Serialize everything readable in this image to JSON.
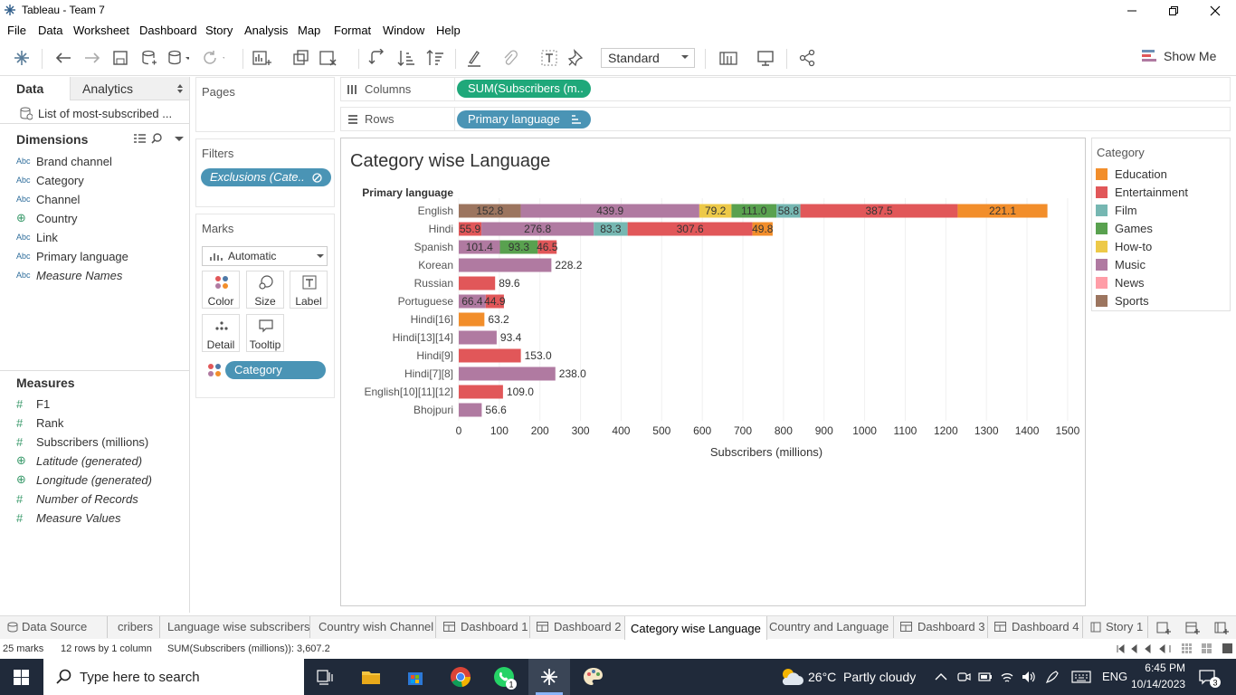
{
  "window": {
    "title": "Tableau - Team 7"
  },
  "menu": [
    "File",
    "Data",
    "Worksheet",
    "Dashboard",
    "Story",
    "Analysis",
    "Map",
    "Format",
    "Window",
    "Help"
  ],
  "toolbar": {
    "mark_type": "Standard",
    "show_me": "Show Me"
  },
  "sidebar": {
    "tabs": [
      "Data",
      "Analytics"
    ],
    "datasource": "List of most-subscribed ...",
    "dimensions_title": "Dimensions",
    "dimensions": [
      {
        "label": "Brand channel",
        "type": "Abc",
        "italic": false
      },
      {
        "label": "Category",
        "type": "Abc",
        "italic": false
      },
      {
        "label": "Channel",
        "type": "Abc",
        "italic": false
      },
      {
        "label": "Country",
        "type": "globe",
        "italic": false
      },
      {
        "label": "Link",
        "type": "Abc",
        "italic": false
      },
      {
        "label": "Primary language",
        "type": "Abc",
        "italic": false
      },
      {
        "label": "Measure Names",
        "type": "Abc",
        "italic": true
      }
    ],
    "measures_title": "Measures",
    "measures": [
      {
        "label": "F1",
        "type": "#",
        "italic": false
      },
      {
        "label": "Rank",
        "type": "#",
        "italic": false
      },
      {
        "label": "Subscribers (millions)",
        "type": "#",
        "italic": false
      },
      {
        "label": "Latitude (generated)",
        "type": "globe",
        "italic": true
      },
      {
        "label": "Longitude (generated)",
        "type": "globe",
        "italic": true
      },
      {
        "label": "Number of Records",
        "type": "#",
        "italic": true
      },
      {
        "label": "Measure Values",
        "type": "#",
        "italic": true
      }
    ]
  },
  "pages": {
    "title": "Pages"
  },
  "filters": {
    "title": "Filters",
    "pill": "Exclusions (Cate.."
  },
  "marks": {
    "title": "Marks",
    "type": "Automatic",
    "buttons": [
      "Color",
      "Size",
      "Label",
      "Detail",
      "Tooltip"
    ],
    "pill": "Category"
  },
  "shelves": {
    "columns_label": "Columns",
    "columns_pill": "SUM(Subscribers (m..",
    "rows_label": "Rows",
    "rows_pill": "Primary language"
  },
  "chart_data": {
    "type": "bar",
    "stacked": true,
    "orientation": "horizontal",
    "title": "Category wise Language",
    "row_header": "Primary language",
    "xlabel": "Subscribers (millions)",
    "xlim": [
      0,
      1500
    ],
    "xticks": [
      0,
      100,
      200,
      300,
      400,
      500,
      600,
      700,
      800,
      900,
      1000,
      1100,
      1200,
      1300,
      1400,
      1500
    ],
    "categories": [
      "English",
      "Hindi",
      "Spanish",
      "Korean",
      "Russian",
      "Portuguese",
      "Hindi[16]",
      "Hindi[13][14]",
      "Hindi[9]",
      "Hindi[7][8]",
      "English[10][11][12]",
      "Bhojpuri"
    ],
    "colors": {
      "Education": "#f28e2b",
      "Entertainment": "#e15759",
      "Film": "#76b7b2",
      "Games": "#59a14f",
      "How-to": "#edc948",
      "Music": "#b07aa1",
      "News": "#ff9da7",
      "Sports": "#9c755f"
    },
    "segments": [
      [
        [
          "Sports",
          152.8
        ],
        [
          "Music",
          439.9
        ],
        [
          "How-to",
          79.2
        ],
        [
          "Games",
          111.0
        ],
        [
          "Film",
          58.8
        ],
        [
          "Entertainment",
          387.5
        ],
        [
          "Education",
          221.1
        ]
      ],
      [
        [
          "Entertainment",
          55.9
        ],
        [
          "Music",
          276.8
        ],
        [
          "Film",
          83.3
        ],
        [
          "Entertainment",
          307.6
        ],
        [
          "Education",
          49.8
        ]
      ],
      [
        [
          "Music",
          101.4
        ],
        [
          "Games",
          93.3
        ],
        [
          "Entertainment",
          46.5
        ]
      ],
      [
        [
          "Music",
          228.2
        ]
      ],
      [
        [
          "Entertainment",
          89.6
        ]
      ],
      [
        [
          "Music",
          66.4
        ],
        [
          "Entertainment",
          44.9
        ]
      ],
      [
        [
          "Education",
          63.2
        ]
      ],
      [
        [
          "Music",
          93.4
        ]
      ],
      [
        [
          "Entertainment",
          153.0
        ]
      ],
      [
        [
          "Music",
          238.0
        ]
      ],
      [
        [
          "Entertainment",
          109.0
        ]
      ],
      [
        [
          "Music",
          56.6
        ]
      ]
    ]
  },
  "legend": {
    "title": "Category",
    "items": [
      {
        "label": "Education",
        "color": "#f28e2b"
      },
      {
        "label": "Entertainment",
        "color": "#e15759"
      },
      {
        "label": "Film",
        "color": "#76b7b2"
      },
      {
        "label": "Games",
        "color": "#59a14f"
      },
      {
        "label": "How-to",
        "color": "#edc948"
      },
      {
        "label": "Music",
        "color": "#b07aa1"
      },
      {
        "label": "News",
        "color": "#ff9da7"
      },
      {
        "label": "Sports",
        "color": "#9c755f"
      }
    ]
  },
  "sheet_tabs": [
    "Data Source",
    "cribers",
    "Language wise subscribers",
    "Country wish Channel",
    "Dashboard 1",
    "Dashboard 2",
    "Category wise Language",
    "Country and Language",
    "Dashboard 3",
    "Dashboard 4",
    "Story 1"
  ],
  "status": {
    "marks": "25 marks",
    "rows": "12 rows by 1 column",
    "sum": "SUM(Subscribers (millions)): 3,607.2"
  },
  "taskbar": {
    "search_placeholder": "Type here to search",
    "weather": "26°C  Partly cloudy",
    "lang": "ENG",
    "time": "6:45 PM",
    "date": "10/14/2023",
    "notifications": "3",
    "whatsapp_badge": "1"
  }
}
